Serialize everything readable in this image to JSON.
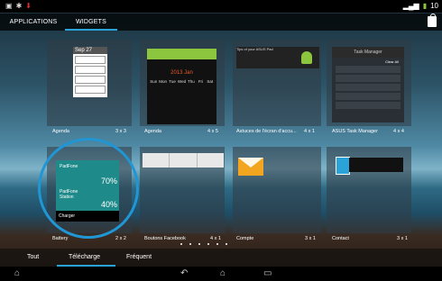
{
  "status_bar": {
    "left_icons": [
      "image-icon",
      "bluetooth-icon",
      "download-icon"
    ],
    "time": "10"
  },
  "tabs": [
    {
      "label": "APPLICATIONS",
      "active": false
    },
    {
      "label": "WIDGETS",
      "active": true
    }
  ],
  "accent_color": "#2aa3d9",
  "widgets": [
    {
      "name": "Agenda",
      "size": "3 x 3",
      "preview_header": "Sep 27"
    },
    {
      "name": "Agenda",
      "size": "4 x 5",
      "preview_header": "2013 Jan"
    },
    {
      "name": "Astuces de l'écran d'accu...",
      "size": "4 x 1",
      "preview_header": "Tips of your ASUS Pad"
    },
    {
      "name": "ASUS Task Manager",
      "size": "4 x 4",
      "preview_header": "Task Manager"
    },
    {
      "name": "Battery",
      "size": "2 x 2"
    },
    {
      "name": "Boutons Facebook",
      "size": "4 x 1"
    },
    {
      "name": "Compte",
      "size": "3 x 1"
    },
    {
      "name": "Contact",
      "size": "3 x 1"
    }
  ],
  "battery_widget": {
    "device1_label": "PadFone",
    "device1_percent": "70%",
    "device2_label": "PadFone Station",
    "device2_percent": "40%",
    "charger_label": "Charger"
  },
  "calendar_days": [
    "Sun",
    "Mon",
    "Tue",
    "Wed",
    "Thu",
    "Fri",
    "Sat"
  ],
  "task_manager_button": "Clear All",
  "bottom_tabs": [
    {
      "label": "Tout",
      "active": false
    },
    {
      "label": "Télécharge",
      "active": true
    },
    {
      "label": "Fréquent",
      "active": false
    }
  ],
  "nav_icons": [
    "back-icon",
    "home-icon",
    "recent-apps-icon"
  ]
}
